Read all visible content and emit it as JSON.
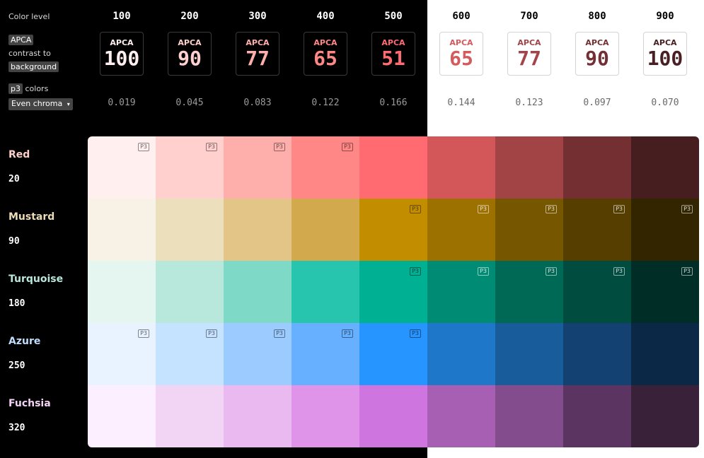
{
  "header": {
    "color_level_label": "Color level",
    "apca_tag": "APCA",
    "contrast_to_label": "contrast to",
    "background_tag": "background",
    "p3_tag": "p3",
    "colors_label": "colors",
    "mode_select": "Even chroma",
    "mode_caret": "▾"
  },
  "levels": [
    {
      "label": "100",
      "apca": "100",
      "lum": "0.019",
      "apca_color": "#ffefee",
      "dark": true
    },
    {
      "label": "200",
      "apca": "90",
      "lum": "0.045",
      "apca_color": "#ffd0cd",
      "dark": true
    },
    {
      "label": "300",
      "apca": "77",
      "lum": "0.083",
      "apca_color": "#ffafab",
      "dark": true
    },
    {
      "label": "400",
      "apca": "65",
      "lum": "0.122",
      "apca_color": "#ff8785",
      "dark": true
    },
    {
      "label": "500",
      "apca": "51",
      "lum": "0.166",
      "apca_color": "#ff6b70",
      "dark": true
    },
    {
      "label": "600",
      "apca": "65",
      "lum": "0.144",
      "apca_color": "#d45a5c",
      "dark": false
    },
    {
      "label": "700",
      "apca": "77",
      "lum": "0.123",
      "apca_color": "#a24548",
      "dark": false
    },
    {
      "label": "800",
      "apca": "90",
      "lum": "0.097",
      "apca_color": "#733034",
      "dark": false
    },
    {
      "label": "900",
      "apca": "100",
      "lum": "0.070",
      "apca_color": "#481f22",
      "dark": false
    }
  ],
  "apca_box_label": "APCA",
  "p3_badge": "P3",
  "hues": [
    {
      "name": "Red",
      "hue": "20",
      "name_color": "#ffcfca",
      "colors": [
        "#ffefee",
        "#ffd0cd",
        "#ffafab",
        "#ff8785",
        "#ff6b70",
        "#d35658",
        "#a24346",
        "#742f32",
        "#471e20"
      ],
      "p3": [
        true,
        true,
        true,
        true,
        false,
        false,
        false,
        false,
        false
      ]
    },
    {
      "name": "Mustard",
      "hue": "90",
      "name_color": "#ecdcb6",
      "colors": [
        "#f7f1e6",
        "#ecdfbb",
        "#e2c587",
        "#d3a94d",
        "#c38d00",
        "#9c7100",
        "#775600",
        "#553e00",
        "#322500"
      ],
      "p3": [
        false,
        false,
        false,
        false,
        true,
        true,
        true,
        true,
        true
      ]
    },
    {
      "name": "Turquoise",
      "hue": "180",
      "name_color": "#b7e8db",
      "colors": [
        "#e5f6f1",
        "#b7e8db",
        "#7fd9c7",
        "#27c5ad",
        "#00b092",
        "#008c74",
        "#006955",
        "#004c3e",
        "#002d25"
      ],
      "p3": [
        false,
        false,
        false,
        false,
        true,
        true,
        true,
        true,
        true
      ]
    },
    {
      "name": "Azure",
      "hue": "250",
      "name_color": "#bddcfe",
      "colors": [
        "#e8f3ff",
        "#c5e2ff",
        "#9ccbff",
        "#67afff",
        "#2795ff",
        "#1f77ca",
        "#185c9c",
        "#124172",
        "#0c2847"
      ],
      "p3": [
        true,
        true,
        true,
        true,
        true,
        false,
        false,
        false,
        false
      ]
    },
    {
      "name": "Fuchsia",
      "hue": "320",
      "name_color": "#f5d3f6",
      "colors": [
        "#fcefff",
        "#f2d5f5",
        "#e9b9f0",
        "#df94e9",
        "#ce75df",
        "#a75fb3",
        "#824c8d",
        "#5b3461",
        "#392139"
      ],
      "p3": [
        false,
        false,
        false,
        false,
        false,
        false,
        false,
        false,
        false
      ]
    }
  ]
}
